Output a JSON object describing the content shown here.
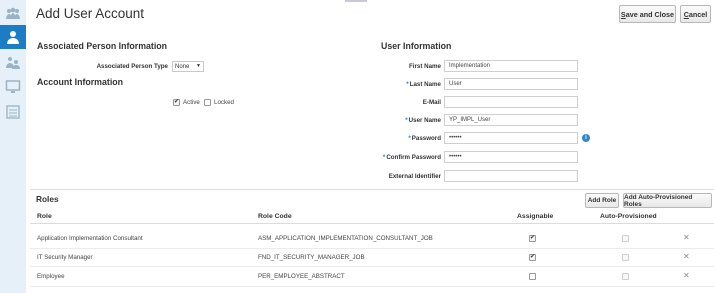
{
  "page": {
    "title": "Add User Account",
    "save_close": {
      "accel": "S",
      "rest": "ave and Close"
    },
    "cancel": {
      "accel": "C",
      "rest": "ancel"
    }
  },
  "rail": {
    "items": [
      "people-group-icon",
      "user-icon",
      "users-network-icon",
      "monitor-icon",
      "list-icon"
    ],
    "active_index": 1
  },
  "associated": {
    "heading": "Associated Person Information",
    "person_type_label": "Associated Person Type",
    "person_type_value": "None"
  },
  "account": {
    "heading": "Account Information",
    "active_label": "Active",
    "active_checked": true,
    "locked_label": "Locked",
    "locked_checked": false
  },
  "user_info": {
    "heading": "User Information",
    "fields": {
      "first_name": {
        "label": "First Name",
        "value": "Implementation",
        "required": false
      },
      "last_name": {
        "label": "Last Name",
        "value": "User",
        "required": true
      },
      "email": {
        "label": "E-Mail",
        "value": "",
        "required": false
      },
      "user_name": {
        "label": "User Name",
        "value": "YP_IMPL_User",
        "required": true
      },
      "password": {
        "label": "Password",
        "value": "••••••",
        "required": true
      },
      "confirm_password": {
        "label": "Confirm Password",
        "value": "••••••",
        "required": true
      },
      "external_identifier": {
        "label": "External Identifier",
        "value": "",
        "required": false
      }
    },
    "required_mark": "*",
    "info_glyph": "i"
  },
  "roles": {
    "heading": "Roles",
    "add_role": "Add Role",
    "add_auto": "Add Auto-Provisioned Roles",
    "columns": {
      "role": "Role",
      "code": "Role Code",
      "assignable": "Assignable",
      "auto": "Auto-Provisioned"
    },
    "rows": [
      {
        "role": "Application Implementation Consultant",
        "code": "ASM_APPLICATION_IMPLEMENTATION_CONSULTANT_JOB",
        "assignable": true,
        "auto": false
      },
      {
        "role": "IT Security Manager",
        "code": "FND_IT_SECURITY_MANAGER_JOB",
        "assignable": true,
        "auto": false
      },
      {
        "role": "Employee",
        "code": "PER_EMPLOYEE_ABSTRACT",
        "assignable": false,
        "auto": false
      }
    ],
    "delete_glyph": "✕"
  },
  "colors": {
    "accent": "#1d7cc6",
    "rail_bg": "#e6f0f8"
  }
}
